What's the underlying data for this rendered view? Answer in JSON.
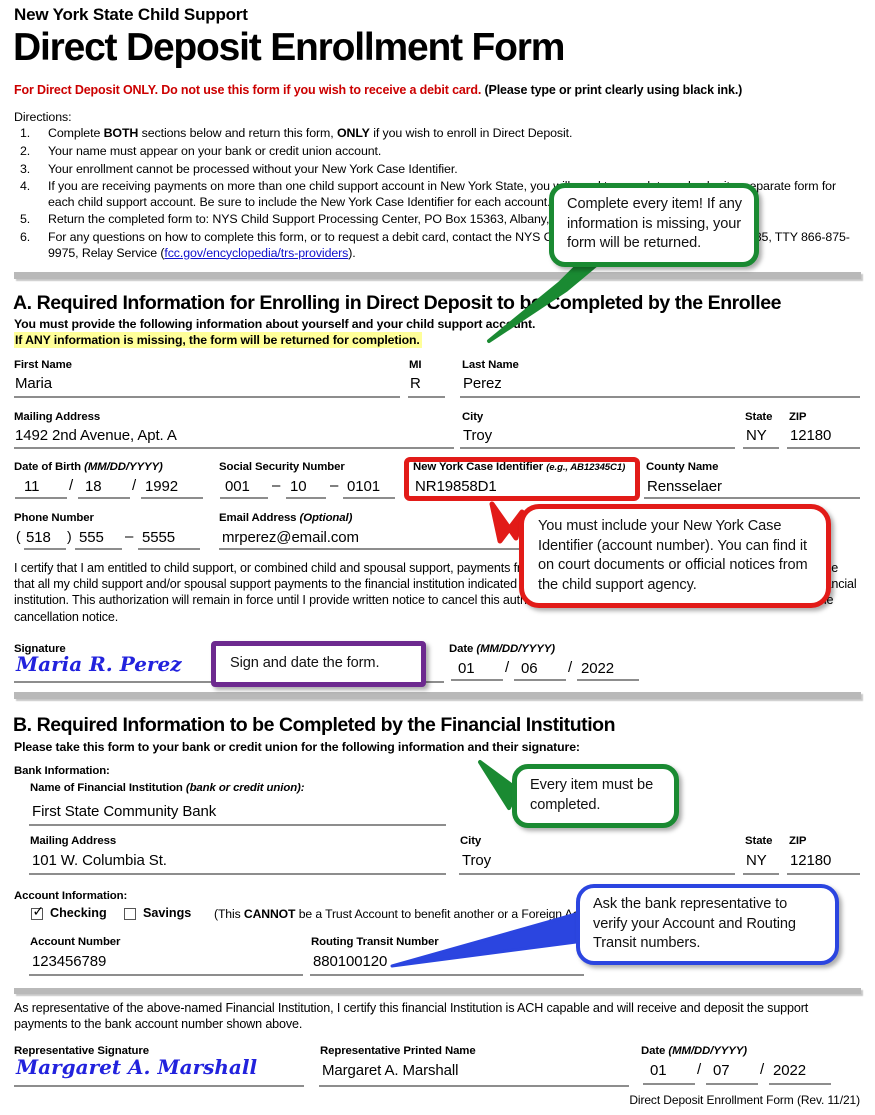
{
  "header": {
    "agency": "New York State Child Support",
    "title": "Direct Deposit Enrollment Form",
    "red_notice_red": "For Direct Deposit ONLY. Do not use this form if you wish to receive a debit card.",
    "red_notice_black": "(Please type or print clearly using black ink.)"
  },
  "directions": {
    "label": "Directions:",
    "items": [
      {
        "num": "1.",
        "html": "Complete <b>BOTH</b> sections below and return this form, <b>ONLY</b> if you wish to enroll in Direct Deposit."
      },
      {
        "num": "2.",
        "html": "Your name must appear on your bank or credit union account."
      },
      {
        "num": "3.",
        "html": "Your enrollment cannot be processed without your New York Case Identifier."
      },
      {
        "num": "4.",
        "html": "If you are receiving payments on more than one child support account in New York State, you will need to complete and submit a separate form for each child support account. Be sure to include the New York Case Identifier for each account."
      },
      {
        "num": "5.",
        "html": "Return the completed form to: NYS Child Support Processing Center, PO Box 15363, Albany, NY 12212-5363."
      },
      {
        "num": "6.",
        "html": "For any questions on how to complete this form, or to request a debit card, contact the NYS Child Support Helpline at 1-888-208-4485, TTY 866-875-9975, Relay Service (<span class=\"lnk\">fcc.gov/encyclopedia/trs-providers</span>)."
      }
    ]
  },
  "section_a": {
    "heading": "A.  Required Information for Enrolling in Direct Deposit to be Completed by the Enrollee",
    "note_line1": "You must provide the following information about yourself and your child support account.",
    "note_line2_highlighted": "If ANY information is missing, the form will be returned for completion.",
    "fields": {
      "first_name_label": "First Name",
      "first_name_value": "Maria",
      "mi_label": "MI",
      "mi_value": "R",
      "last_name_label": "Last Name",
      "last_name_value": "Perez",
      "mailing_address_label": "Mailing Address",
      "mailing_address_value": "1492 2nd Avenue, Apt. A",
      "city_label": "City",
      "city_value": "Troy",
      "state_label": "State",
      "state_value": "NY",
      "zip_label": "ZIP",
      "zip_value": "12180",
      "dob_label": "Date of Birth",
      "dob_label_format": "(MM/DD/YYYY)",
      "dob_month": "11",
      "dob_day": "18",
      "dob_year": "1992",
      "ssn_label": "Social Security Number",
      "ssn_part1": "001",
      "ssn_part2": "10",
      "ssn_part3": "0101",
      "case_id_label": "New York Case Identifier",
      "case_id_label_example": "(e.g., AB12345C1)",
      "case_id_value": "NR19858D1",
      "county_label": "County Name",
      "county_value": "Rensselaer",
      "phone_label": "Phone Number",
      "phone_area": "518",
      "phone_part1": "555",
      "phone_part2": "5555",
      "email_label": "Email Address",
      "email_label_optional": "(Optional)",
      "email_value": "mrperez@email.com"
    },
    "certification": "I certify that I am entitled to child support, or combined child and spousal support, payments from the New York State Child Support Program. I authorize that all my child support and/or spousal support payments to the financial institution indicated below by electronic funds transfer as indicated by the financial institution. This authorization will remain in force until I provide written notice to cancel this authorization and I agree to a reasonable time to process the cancellation notice.",
    "signature_label": "Signature",
    "signature_value": "Maria R. Perez",
    "date_label": "Date",
    "date_label_format": "(MM/DD/YYYY)",
    "date_month": "01",
    "date_day": "06",
    "date_year": "2022"
  },
  "section_b": {
    "heading": "B.  Required Information to be Completed by the Financial Institution",
    "note": "Please take this form to your bank or credit union for the following information and their signature:",
    "bank_info_label": "Bank Information:",
    "fi_name_label": "Name of Financial Institution",
    "fi_name_label_paren": "(bank or credit union):",
    "fi_name_value": "First State Community Bank",
    "mailing_address_label": "Mailing Address",
    "mailing_address_value": "101 W. Columbia St.",
    "city_label": "City",
    "city_value": "Troy",
    "state_label": "State",
    "state_value": "NY",
    "zip_label": "ZIP",
    "zip_value": "12180",
    "account_info_label": "Account Information:",
    "checking_label": "Checking",
    "checking_checked": true,
    "savings_label": "Savings",
    "savings_checked": false,
    "account_type_note": "(This CANNOT be a Trust Account to benefit another or a Foreign Account.)",
    "account_number_label": "Account Number",
    "account_number_value": "123456789",
    "routing_label": "Routing Transit Number",
    "routing_value": "880100120",
    "rep_certification": "As representative of the above-named Financial Institution, I certify this financial Institution is ACH capable and will receive and deposit the support payments to the bank account number shown above.",
    "rep_signature_label": "Representative Signature",
    "rep_signature_value": "Margaret A. Marshall",
    "rep_name_label": "Representative Printed Name",
    "rep_name_value": "Margaret A. Marshall",
    "rep_date_label": "Date",
    "rep_date_label_format": "(MM/DD/YYYY)",
    "rep_date_month": "01",
    "rep_date_day": "07",
    "rep_date_year": "2022"
  },
  "callouts": {
    "green_top": "Complete every item! If any information is missing, your form will be returned.",
    "red_case_id": "You must include your New York Case Identifier (account number). You can find it on court documents or official notices from the child support agency.",
    "purple_sign": "Sign and date the form.",
    "green_bank": "Every item must be completed.",
    "blue_verify": "Ask the bank representative to verify your Account and Routing Transit numbers."
  },
  "footer": {
    "revision": "Direct Deposit Enrollment Form (Rev. 11/21)"
  },
  "colors": {
    "green": "#1a8a32",
    "red": "#e21b18",
    "blue": "#2b45e0",
    "purple": "#6d2a8f",
    "highlight": "#ffff99",
    "notice_red": "#cc0000",
    "signature_blue": "#2222dd"
  }
}
